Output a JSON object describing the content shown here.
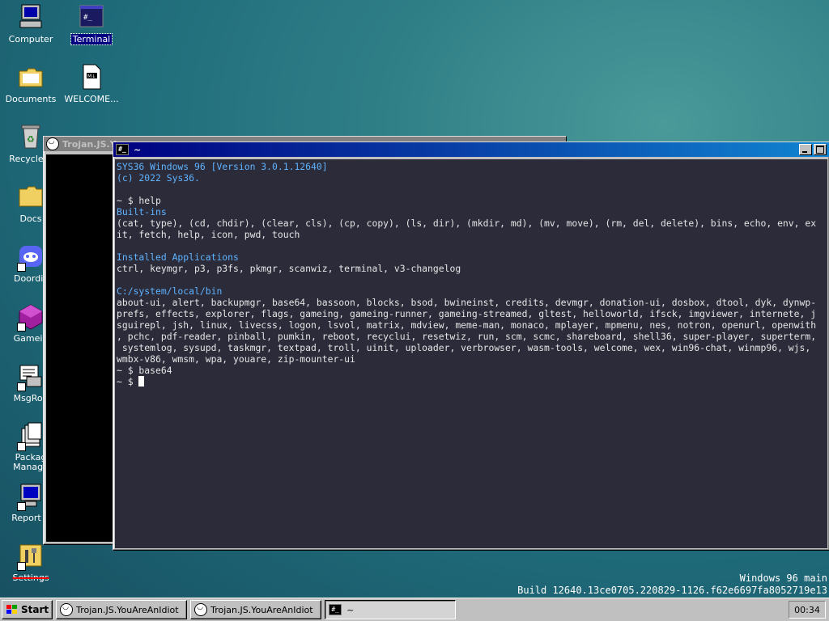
{
  "desktop": {
    "icons": [
      {
        "label": "Computer"
      },
      {
        "label": "Terminal"
      },
      {
        "label": "Documents"
      },
      {
        "label": "WELCOME..."
      },
      {
        "label": "Recycle B"
      },
      {
        "label": "Docs"
      },
      {
        "label": "Doordis"
      },
      {
        "label": "Gamein"
      },
      {
        "label": "MsgRoo"
      },
      {
        "label": "Packag Manage"
      },
      {
        "label": "Report B"
      },
      {
        "label": "Settings"
      }
    ]
  },
  "background_window": {
    "title": "Trojan.JS.Y"
  },
  "terminal": {
    "title": "~",
    "lines": [
      "SYS36 Windows 96 [Version 3.0.1.12640]",
      "(c) 2022 Sys36.",
      "",
      "~ $ help",
      "Built-ins",
      "(cat, type), (cd, chdir), (clear, cls), (cp, copy), (ls, dir), (mkdir, md), (mv, move), (rm, del, delete), bins, echo, env, ex",
      "it, fetch, help, icon, pwd, touch",
      "",
      "Installed Applications",
      "ctrl, keymgr, p3, p3fs, pkmgr, scanwiz, terminal, v3-changelog",
      "",
      "C:/system/local/bin",
      "about-ui, alert, backupmgr, base64, bassoon, blocks, bsod, bwineinst, credits, devmgr, donation-ui, dosbox, dtool, dyk, dynwp-",
      "prefs, effects, explorer, flags, gameing, gameing-runner, gameing-streamed, gltest, helloworld, ifsck, imgviewer, internete, j",
      "sguirepl, jsh, linux, livecss, logon, lsvol, matrix, mdview, meme-man, monaco, mplayer, mpmenu, nes, notron, openurl, openwith",
      ", pchc, pdf-reader, pinball, pumkin, reboot, recyclui, resetwiz, run, scm, scmc, shareboard, shell36, super-player, superterm,",
      " systemlog, sysupd, taskmgr, textpad, troll, uinit, uploader, verbrowser, wasm-tools, welcome, wex, win96-chat, winmp96, wjs,",
      "wmbx-v86, wmsm, wpa, youare, zip-mounter-ui",
      "~ $ base64",
      "~ $ "
    ]
  },
  "watermark": {
    "line1": "Windows 96 main",
    "line2": "Build 12640.13ce0705.220829-1126.f62e6697fa8052719e13"
  },
  "taskbar": {
    "start_label": "Start",
    "tasks": [
      {
        "label": "Trojan.JS.YouAreAnIdiot"
      },
      {
        "label": "Trojan.JS.YouAreAnIdiot"
      },
      {
        "label": "~"
      }
    ],
    "clock": "00:34"
  },
  "colors": {
    "terminal_bg": "#2b2b3a",
    "terminal_fg": "#e6e6e6",
    "terminal_accent": "#5fb3ff",
    "title_active": "#000080"
  }
}
